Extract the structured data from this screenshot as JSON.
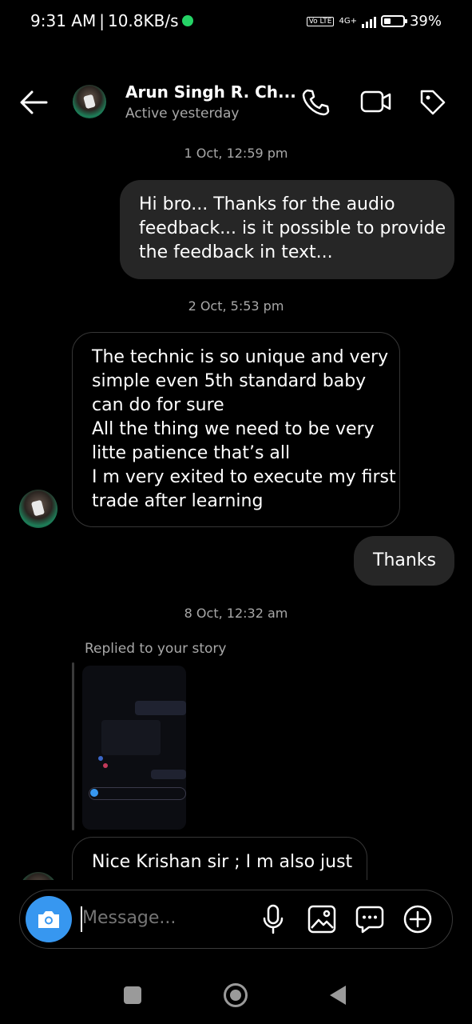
{
  "status_bar": {
    "time": "9:31 AM",
    "speed": "10.8KB/s",
    "network": "4G+",
    "volte": "Vo LTE",
    "battery": "39%"
  },
  "header": {
    "name": "Arun Singh R. Ch...",
    "status": "Active yesterday",
    "icons": [
      "back-arrow-icon",
      "phone-icon",
      "video-camera-icon",
      "tag-icon"
    ]
  },
  "messages": [
    {
      "type": "timestamp",
      "text": "1 Oct, 12:59 pm"
    },
    {
      "type": "outgoing",
      "lines": [
        "Hi bro...  Thanks for the audio",
        "feedback... is it possible to provide",
        "the feedback in text..."
      ]
    },
    {
      "type": "timestamp",
      "text": "2 Oct, 5:53 pm"
    },
    {
      "type": "incoming",
      "lines": [
        "The technic is so unique and very",
        "simple even 5th standard baby",
        "can do for sure",
        "All the thing we need to be very",
        "litte patience that’s all",
        "I m very exited to execute my first",
        "trade after learning"
      ]
    },
    {
      "type": "outgoing",
      "lines": [
        "Thanks"
      ]
    },
    {
      "type": "timestamp",
      "text": "8 Oct, 12:32 am"
    },
    {
      "type": "story_reply",
      "label": "Replied to your story"
    },
    {
      "type": "incoming",
      "lines": [
        "Nice Krishan sir ; I m also just"
      ]
    }
  ],
  "input": {
    "placeholder": "Message...",
    "icons": [
      "camera-icon",
      "microphone-icon",
      "gallery-icon",
      "sticker-chat-icon",
      "plus-icon"
    ]
  },
  "colors": {
    "background": "#000000",
    "bubble_out": "#262626",
    "bubble_in_border": "#363636",
    "secondary_text": "#a8a8a8",
    "camera_button": "#3797f0"
  }
}
